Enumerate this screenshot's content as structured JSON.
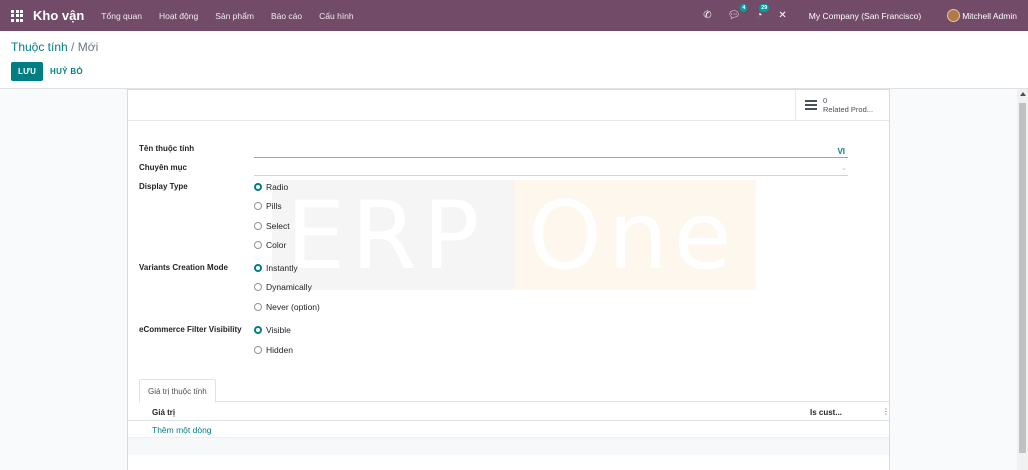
{
  "navbar": {
    "brand": "Kho vận",
    "menu": [
      "Tổng quan",
      "Hoạt động",
      "Sản phẩm",
      "Báo cáo",
      "Cấu hình"
    ],
    "phone_icon": "phone-icon",
    "messages_badge": "4",
    "activities_badge": "29",
    "close_icon": "close-icon",
    "company": "My Company (San Francisco)",
    "user": "Mitchell Admin"
  },
  "breadcrumb": {
    "parent": "Thuộc tính",
    "separator": "/",
    "current": "Mới"
  },
  "actions": {
    "save": "LƯU",
    "discard": "HUỶ BỎ"
  },
  "stat_button": {
    "value": "0",
    "label": "Related Prod..."
  },
  "form": {
    "name_label": "Tên thuộc tính",
    "name_value": "",
    "lang": "VI",
    "category_label": "Chuyên mục",
    "category_value": "",
    "display_type_label": "Display Type",
    "display_type_options": [
      "Radio",
      "Pills",
      "Select",
      "Color"
    ],
    "display_type_selected": "Radio",
    "variants_label": "Variants Creation Mode",
    "variants_options": [
      "Instantly",
      "Dynamically",
      "Never (option)"
    ],
    "variants_selected": "Instantly",
    "ecommerce_label": "eCommerce Filter Visibility",
    "ecommerce_options": [
      "Visible",
      "Hidden"
    ],
    "ecommerce_selected": "Visible"
  },
  "watermark": {
    "left": "ERP",
    "right": "One"
  },
  "tabs": [
    "Giá trị thuộc tính"
  ],
  "list": {
    "columns": [
      "Giá trị",
      "Is cust..."
    ],
    "add_line": "Thêm một dòng"
  },
  "colors": {
    "navbar": "#714b67",
    "accent": "#017e84"
  }
}
